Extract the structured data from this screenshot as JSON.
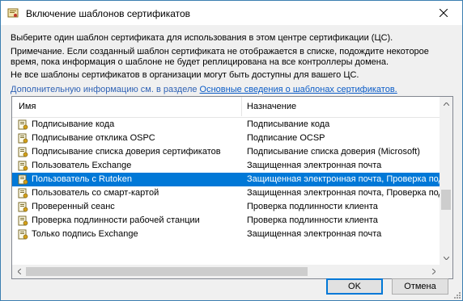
{
  "window": {
    "title": "Включение шаблонов сертификатов"
  },
  "description": {
    "line1": "Выберите один шаблон сертификата для использования в этом центре сертификации (ЦС).",
    "line2": "Примечание. Если созданный шаблон сертификата не отображается в списке, подождите некоторое",
    "line3": "время, пока информация о шаблоне не будет реплицирована на все контроллеры домена.",
    "line4": "Не все шаблоны сертификатов в организации могут быть доступны для вашего ЦС.",
    "link_prefix": "Дополнительную информацию см. в разделе ",
    "link_text": "Основные сведения о шаблонах сертификатов."
  },
  "list": {
    "columns": {
      "name": "Имя",
      "purpose": "Назначение"
    },
    "rows": [
      {
        "name": "Подписывание кода",
        "purpose": "Подписывание кода",
        "selected": false
      },
      {
        "name": "Подписывание отклика OSPC",
        "purpose": "Подписание OCSP",
        "selected": false
      },
      {
        "name": "Подписывание списка доверия сертификатов",
        "purpose": "Подписывание списка доверия (Microsoft)",
        "selected": false
      },
      {
        "name": "Пользователь Exchange",
        "purpose": "Защищенная электронная почта",
        "selected": false
      },
      {
        "name": "Пользователь с Rutoken",
        "purpose": "Защищенная электронная почта, Проверка подлинности клиента",
        "selected": true
      },
      {
        "name": "Пользователь со смарт-картой",
        "purpose": "Защищенная электронная почта, Проверка подлинности клиента",
        "selected": false
      },
      {
        "name": "Проверенный сеанс",
        "purpose": "Проверка подлинности клиента",
        "selected": false
      },
      {
        "name": "Проверка подлинности рабочей станции",
        "purpose": "Проверка подлинности клиента",
        "selected": false
      },
      {
        "name": "Только подпись Exchange",
        "purpose": "Защищенная электронная почта",
        "selected": false
      }
    ]
  },
  "buttons": {
    "ok": "OK",
    "cancel": "Отмена"
  },
  "colors": {
    "selection": "#0078d7",
    "link": "#0b5cc7",
    "border": "#3c7fb1"
  }
}
